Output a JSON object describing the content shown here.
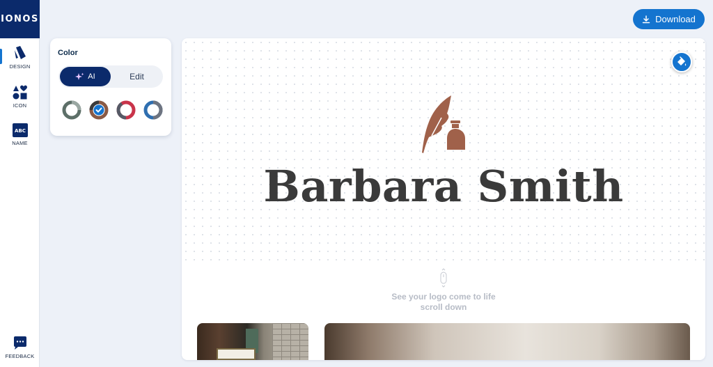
{
  "brand": {
    "logo_text": "IONOS"
  },
  "rail": {
    "design_label": "DESIGN",
    "icon_label": "ICON",
    "name_label": "NAME",
    "feedback_label": "FEEDBACK"
  },
  "toolbar": {
    "download_label": "Download"
  },
  "color_panel": {
    "title": "Color",
    "ai_label": "AI",
    "edit_label": "Edit",
    "swatches": [
      {
        "ring": "#5d6f68",
        "inner": "#ffffff",
        "selected": false
      },
      {
        "ring": "#8a5a45",
        "inner": "#ffffff",
        "selected": true
      },
      {
        "ring": "#c9344a",
        "inner": "#ffffff",
        "selected": false
      },
      {
        "ring": "#2f6fb0",
        "inner": "#ffffff",
        "selected": false
      }
    ]
  },
  "preview": {
    "logo_name": "Barbara Smith",
    "scroll_line1": "See your logo come to life",
    "scroll_line2": "scroll down"
  },
  "colors": {
    "accent": "#1474cf",
    "brand_navy": "#0b2a6b",
    "logo_icon": "#a0614a",
    "logo_text": "#3a3a3a"
  }
}
